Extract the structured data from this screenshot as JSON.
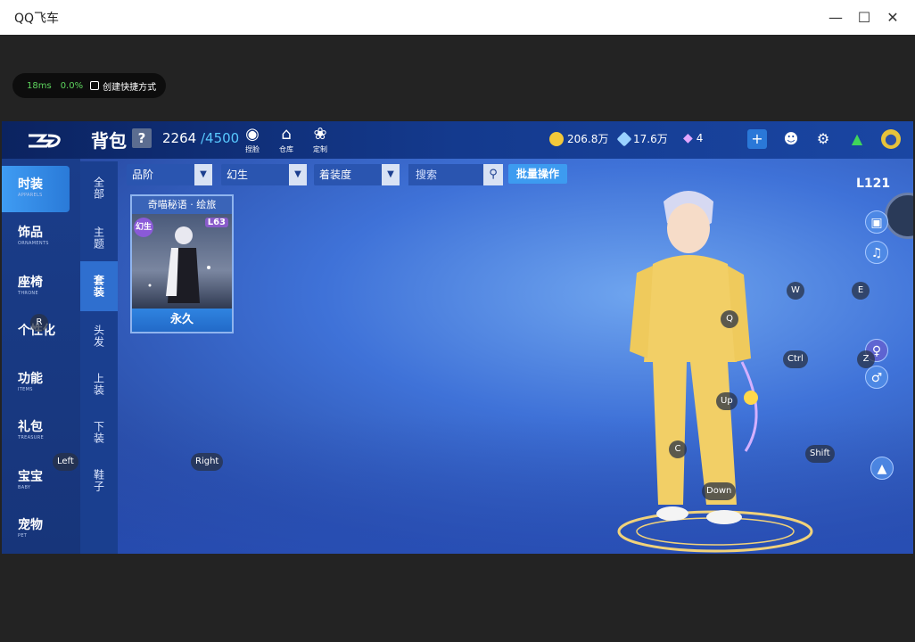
{
  "window": {
    "title": "QQ飞车"
  },
  "stats": {
    "ping": "18ms",
    "loss": "0.0%",
    "shortcut": "创建快捷方式"
  },
  "header": {
    "title": "背包",
    "help": "?",
    "capacity_used": "2264",
    "capacity_max": "/4500",
    "icons": [
      {
        "label": "捏脸",
        "icon": "face-icon"
      },
      {
        "label": "仓库",
        "icon": "warehouse-icon"
      },
      {
        "label": "定制",
        "icon": "custom-icon"
      }
    ],
    "currencies": [
      {
        "value": "206.8万",
        "icon": "coin-icon",
        "color": "#f3c93a"
      },
      {
        "value": "17.6万",
        "icon": "ticket-icon",
        "color": "#9ad2ff"
      },
      {
        "value": "4",
        "icon": "diamond-icon",
        "color": "#e2a6ff"
      }
    ]
  },
  "leftnav": {
    "items": [
      {
        "cn": "时装",
        "en": "APPARELS"
      },
      {
        "cn": "饰品",
        "en": "ORNAMENTS"
      },
      {
        "cn": "座椅",
        "en": "THRONE"
      },
      {
        "cn": "个性化",
        "en": ""
      },
      {
        "cn": "功能",
        "en": "ITEMS"
      },
      {
        "cn": "礼包",
        "en": "TREASURE"
      },
      {
        "cn": "宝宝",
        "en": "BABY"
      },
      {
        "cn": "宠物",
        "en": "PET"
      }
    ]
  },
  "subnav": {
    "items": [
      "全部",
      "主题",
      "套装",
      "头发",
      "上装",
      "下装",
      "鞋子"
    ]
  },
  "filters": {
    "grade": "品阶",
    "fantasy": "幻生",
    "wear": "着装度",
    "search_placeholder": "搜索",
    "batch": "批量操作"
  },
  "card": {
    "name": "奇喵秘语 · 绘旅",
    "tag": "幻生",
    "level": "L63",
    "duration": "永久"
  },
  "character": {
    "level": "L121"
  },
  "keys": {
    "R": "R",
    "Left": "Left",
    "Right": "Right",
    "Q": "Q",
    "W": "W",
    "E": "E",
    "Ctrl": "Ctrl",
    "Z": "Z",
    "Up": "Up",
    "C": "C",
    "Shift": "Shift",
    "Down": "Down"
  }
}
